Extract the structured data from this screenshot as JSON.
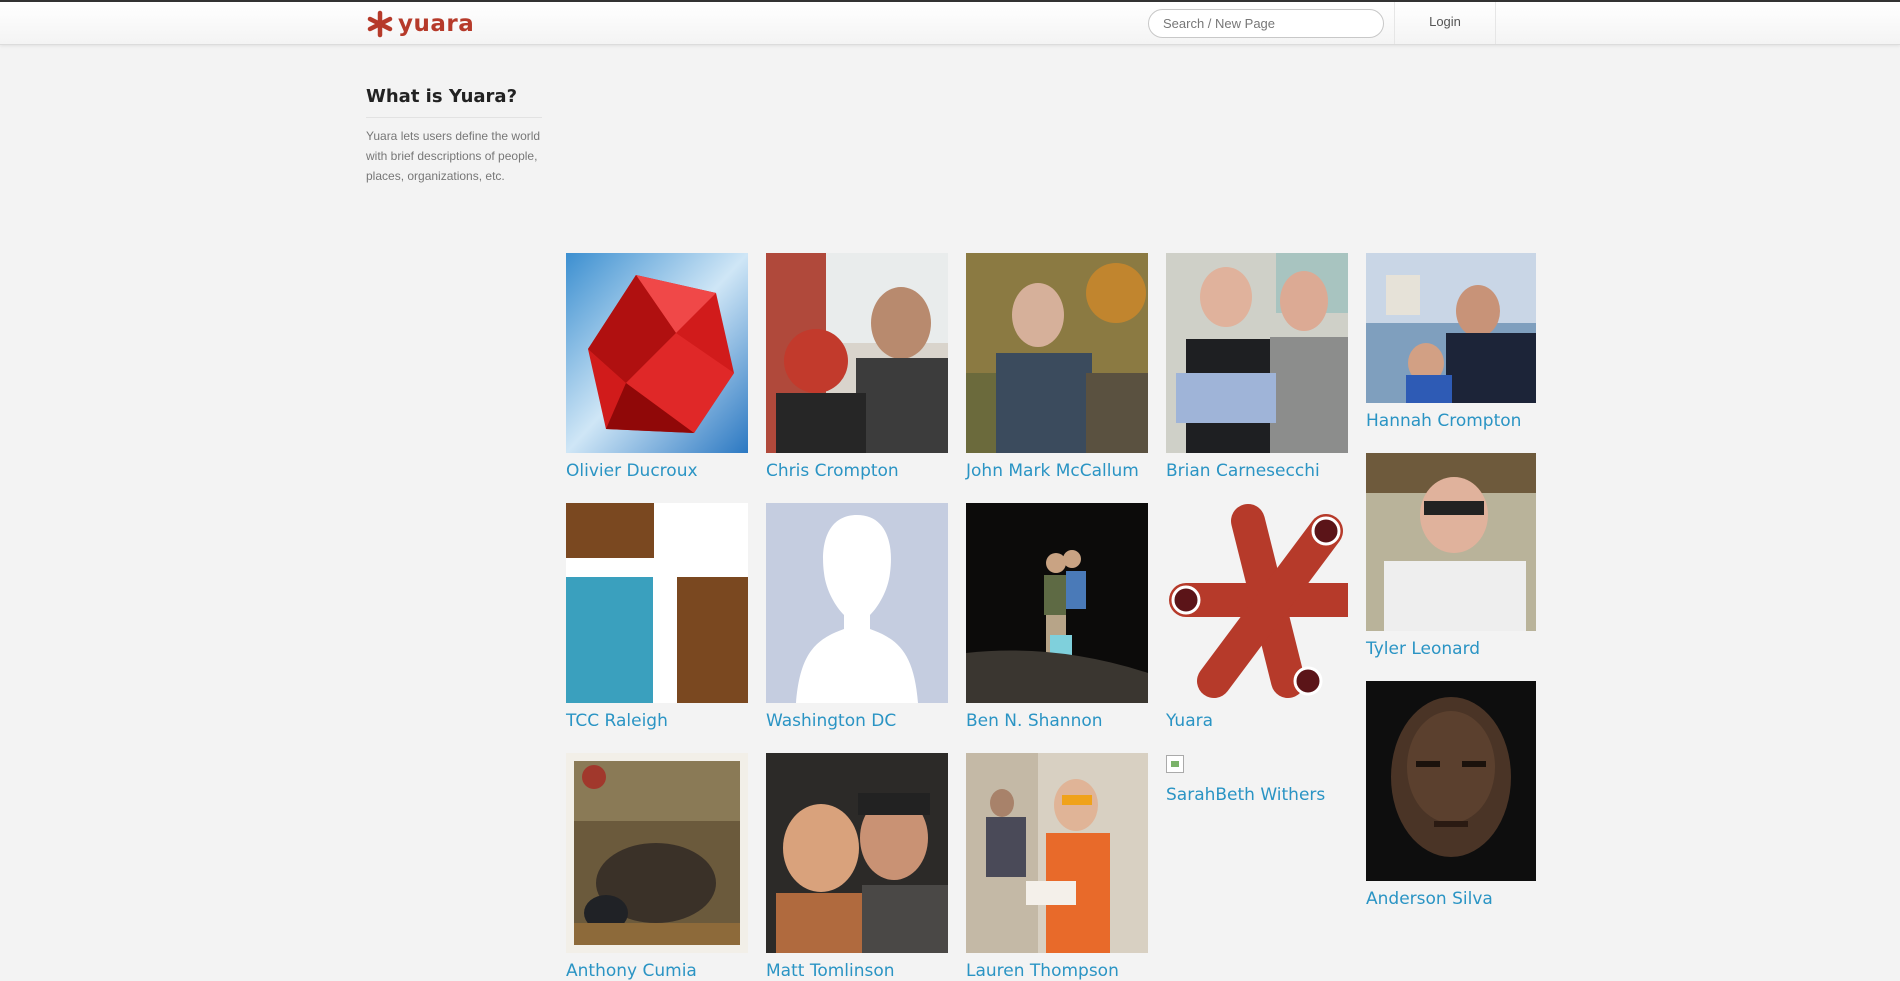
{
  "header": {
    "logo_text": "yuara",
    "search_placeholder": "Search / New Page",
    "login_label": "Login"
  },
  "about": {
    "title_prefix": "What is",
    "title_emphasis": "Yuara?",
    "description": "Yuara lets users define the world with brief descriptions of people, places, organizations, etc."
  },
  "people": [
    {
      "name": "Olivier Ducroux",
      "image": "ruby-gem-logo"
    },
    {
      "name": "Chris Crompton",
      "image": "photo-man-with-child-spiderman-facepaint"
    },
    {
      "name": "John Mark McCallum",
      "image": "photo-man-outdoors-forest"
    },
    {
      "name": "Brian Carnesecchi",
      "image": "photo-two-men-holding-baby"
    },
    {
      "name": "Hannah Crompton",
      "image": "photo-woman-and-child-capitol"
    },
    {
      "name": "TCC Raleigh",
      "image": "tcc-logo-blocks"
    },
    {
      "name": "Washington DC",
      "image": "default-silhouette"
    },
    {
      "name": "Ben N. Shannon",
      "image": "photo-family-night-beach"
    },
    {
      "name": "Yuara",
      "image": "yuara-asterisk-logo"
    },
    {
      "name": "Tyler Leonard",
      "image": "photo-man-sunglasses"
    },
    {
      "name": "SarahBeth Withers",
      "image": "broken-image"
    },
    {
      "name": "Anderson Silva",
      "image": "photo-man-portrait"
    },
    {
      "name": "Anthony Cumia",
      "image": "photo-sniper-grass"
    },
    {
      "name": "Matt Tomlinson",
      "image": "photo-couple-selfie"
    },
    {
      "name": "Lauren Thompson",
      "image": "photo-woman-party-glasses"
    }
  ],
  "colors": {
    "brand": "#b63a2a",
    "link": "#2a94c4",
    "tcc_brown": "#7a4820",
    "tcc_blue": "#3aa0be",
    "silhouette_bg": "#c5cde0"
  }
}
